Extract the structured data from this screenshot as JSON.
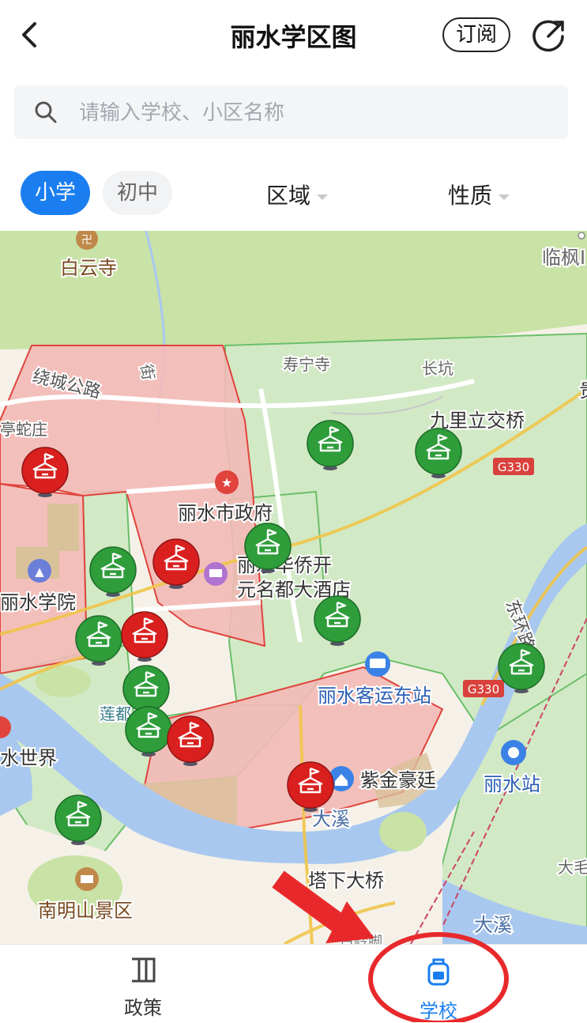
{
  "header": {
    "title": "丽水学区图",
    "subscribe_label": "订阅"
  },
  "search": {
    "placeholder": "请输入学校、小区名称"
  },
  "filters": {
    "tab_primary": "小学",
    "tab_middle": "初中",
    "region": "区域",
    "nature": "性质"
  },
  "map": {
    "labels": {
      "baiyunsi": "白云寺",
      "linfeng": "临枫I",
      "shouningsi": "寿宁寺",
      "changkeng": "长坑",
      "raocheng": "绕城公路",
      "tingshe": "亭蛇庄",
      "jiulili": "九里立交桥",
      "g330": "G330",
      "gov": "丽水市政府",
      "hotel1": "丽水华侨开",
      "hotel2": "元名都大酒店",
      "univ": "丽水学院",
      "huanlu": "东环路",
      "bus": "丽水客运东站",
      "shuishijie": "水世界",
      "zijin": "紫金豪廷",
      "daxi": "大溪",
      "lishui_station": "丽水站",
      "taxia": "塔下大桥",
      "nanming": "南明山景区",
      "damao": "大毛",
      "daxi2": "大溪",
      "lian": "莲都",
      "bailing": "白岭脚",
      "jie": "街",
      "gui": "贵"
    }
  },
  "tabs": {
    "policy": "政策",
    "school": "学校"
  },
  "colors": {
    "accent": "#1a7ef0",
    "public_school": "#2e9d3a",
    "private_school": "#d9201f",
    "annotation": "#e8292b"
  }
}
